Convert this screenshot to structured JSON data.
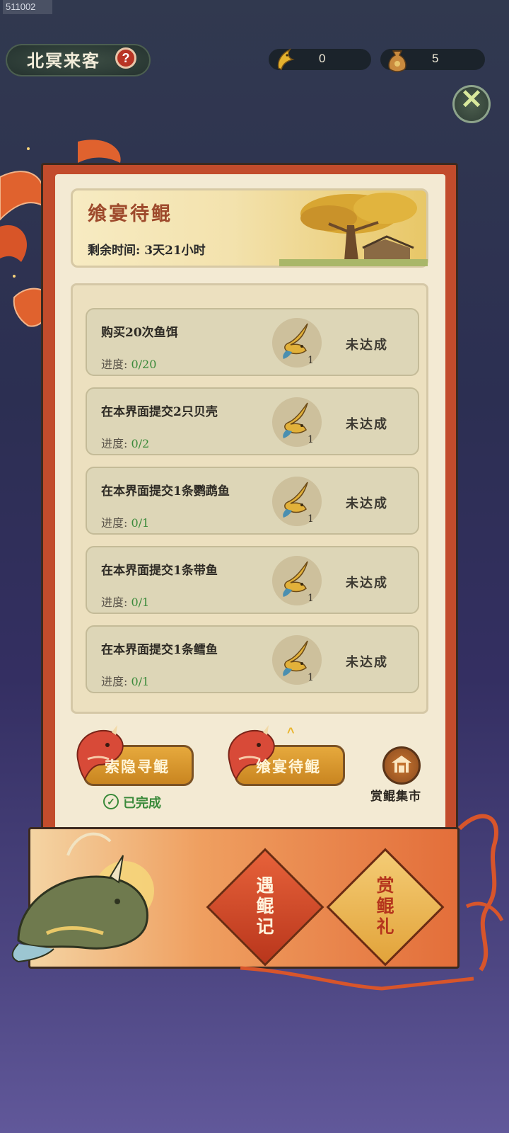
{
  "build_id": "511002",
  "header": {
    "title": "北冥来客",
    "help_icon": "question-mark-icon",
    "help_glyph": "?",
    "currencies": [
      {
        "icon": "golden-fish-icon",
        "value": "0"
      },
      {
        "icon": "bait-sack-icon",
        "value": "5"
      }
    ],
    "close_icon": "close-x-icon",
    "close_glyph": "✕"
  },
  "event": {
    "title": "飨宴待鲲",
    "remaining_time": "剩余时间: 3天21小时"
  },
  "tasks": [
    {
      "title": "购买20次鱼饵",
      "progress_label": "进度: ",
      "progress_value": "0/20",
      "reward_icon": "kun-fish-token-icon",
      "reward_count": "1",
      "status": "未达成"
    },
    {
      "title": "在本界面提交2只贝壳",
      "progress_label": "进度: ",
      "progress_value": "0/2",
      "reward_icon": "kun-fish-token-icon",
      "reward_count": "1",
      "status": "未达成"
    },
    {
      "title": "在本界面提交1条鹦鹉鱼",
      "progress_label": "进度: ",
      "progress_value": "0/1",
      "reward_icon": "kun-fish-token-icon",
      "reward_count": "1",
      "status": "未达成"
    },
    {
      "title": "在本界面提交1条带鱼",
      "progress_label": "进度: ",
      "progress_value": "0/1",
      "reward_icon": "kun-fish-token-icon",
      "reward_count": "1",
      "status": "未达成"
    },
    {
      "title": "在本界面提交1条鳕鱼",
      "progress_label": "进度: ",
      "progress_value": "0/1",
      "reward_icon": "kun-fish-token-icon",
      "reward_count": "1",
      "status": "未达成"
    }
  ],
  "tabs": {
    "tab1_label": "索隐寻鲲",
    "tab1_done": "已完成",
    "tab1_done_glyph": "✓",
    "tab2_label": "飨宴待鲲",
    "tab2_arrow_glyph": "^",
    "market_label": "赏鲲集市",
    "market_icon": "market-pavilion-icon"
  },
  "scroll": {
    "btn1_label": "遇鲲记",
    "btn2_label": "赏鲲礼"
  },
  "colors": {
    "frame_red": "#c24c2c",
    "progress_green": "#3a8a3a",
    "button_gold": "#d9952c",
    "banner_title": "#9e4a2c"
  }
}
